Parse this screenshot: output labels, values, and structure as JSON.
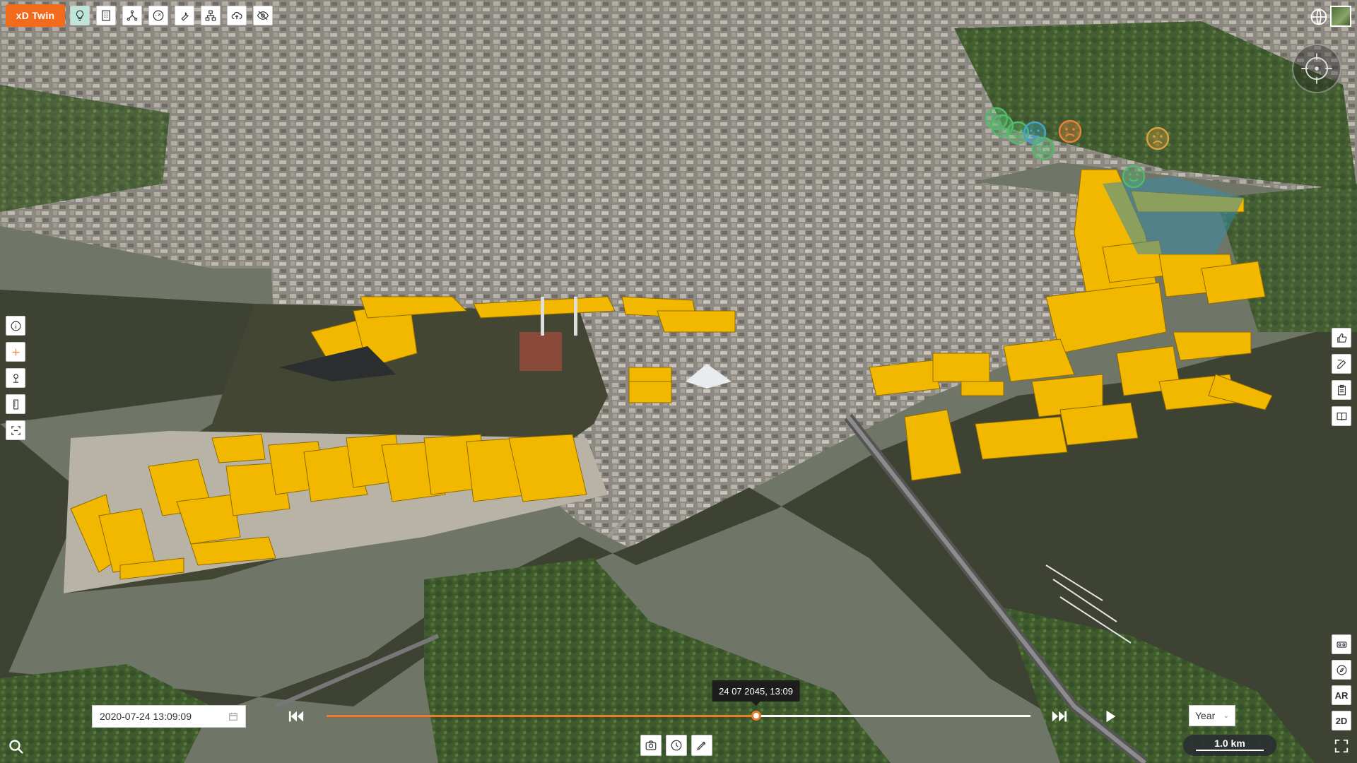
{
  "app": {
    "brand_label": "xD Twin"
  },
  "toolbar": {
    "tools": [
      {
        "name": "lightbulb-icon",
        "active": true
      },
      {
        "name": "building-icon",
        "active": false
      },
      {
        "name": "network-icon",
        "active": false
      },
      {
        "name": "gauge-icon",
        "active": false
      },
      {
        "name": "wrench-icon",
        "active": false
      },
      {
        "name": "hierarchy-icon",
        "active": false
      },
      {
        "name": "cloud-upload-icon",
        "active": false
      },
      {
        "name": "eye-off-icon",
        "active": false
      }
    ]
  },
  "left_tools": [
    "info-icon",
    "plus-icon",
    "pin-icon",
    "ruler-icon",
    "frame-icon"
  ],
  "right_tools": [
    "thumbs-up-icon",
    "edit-icon",
    "clipboard-icon",
    "book-icon"
  ],
  "view_tools": {
    "vr_icon": "vr-icon",
    "compass_icon": "compass-icon",
    "ar_label": "AR",
    "mode_2d_label": "2D"
  },
  "timeline": {
    "date_value": "2020-07-24 13:09:09",
    "tooltip": "24 07 2045, 13:09",
    "progress": 0.61,
    "period_value": "Year"
  },
  "bottom_tools": [
    "camera-icon",
    "clock-icon",
    "pen-icon"
  ],
  "scale": {
    "label": "1.0 km"
  },
  "colors": {
    "brand": "#f26b1d",
    "accent": "#f07a2a",
    "building_highlight": "#f2b800",
    "water": "#3e4232"
  },
  "markers": [
    {
      "mood": "happy",
      "color": "#54b96a"
    },
    {
      "mood": "happy",
      "color": "#54b96a"
    },
    {
      "mood": "happy",
      "color": "#54b96a"
    },
    {
      "mood": "neutral",
      "color": "#3fa6c9"
    },
    {
      "mood": "happy",
      "color": "#54b96a"
    },
    {
      "mood": "sad",
      "color": "#e8833a"
    },
    {
      "mood": "sad",
      "color": "#d9a13b"
    },
    {
      "mood": "happy",
      "color": "#54b96a"
    }
  ]
}
